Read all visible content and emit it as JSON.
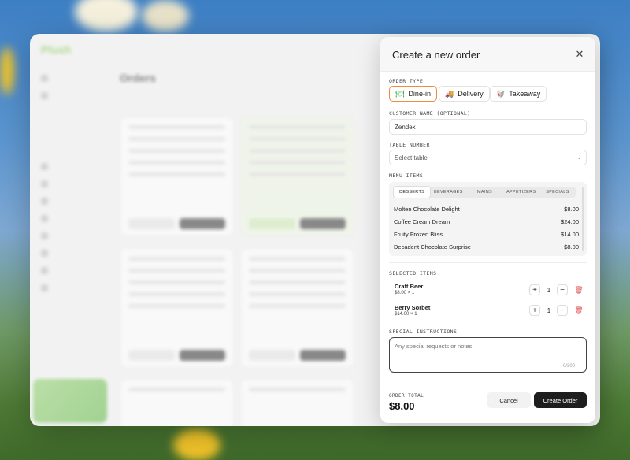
{
  "background": {
    "colors": {
      "sky": "#3d7fc4",
      "grass": "#4d7a35",
      "flower": "#f5f0dc",
      "yellow": "#f2c42a"
    }
  },
  "app": {
    "logo": "Plush",
    "search_placeholder": "",
    "orders_title": "Orders",
    "orders_subtitle": "",
    "accent": "#7ac943"
  },
  "panel": {
    "title": "Create a new order",
    "close_icon": "close-icon",
    "order_type": {
      "label": "ORDER TYPE",
      "options": [
        {
          "label": "Dine-in",
          "icon": "dine-in-icon",
          "active": true
        },
        {
          "label": "Delivery",
          "icon": "delivery-truck-icon",
          "active": false
        },
        {
          "label": "Takeaway",
          "icon": "takeaway-icon",
          "active": false
        }
      ],
      "accent": "#f08a3c"
    },
    "customer": {
      "label": "CUSTOMER NAME (OPTIONAL)",
      "value": "Zendex"
    },
    "table": {
      "label": "TABLE NUMBER",
      "placeholder": "Select table"
    },
    "menu": {
      "label": "MENU ITEMS",
      "tabs": [
        "DESSERTS",
        "BEVERAGES",
        "MAINS",
        "APPETIZERS",
        "SPECIALS"
      ],
      "active_tab": "DESSERTS",
      "items": [
        {
          "name": "Molten Chocolate Delight",
          "price": "$8.00"
        },
        {
          "name": "Coffee Cream Dream",
          "price": "$24.00"
        },
        {
          "name": "Fruity Frozen Bliss",
          "price": "$14.00"
        },
        {
          "name": "Decadent Chocolate Surprise",
          "price": "$8.00"
        }
      ]
    },
    "selected": {
      "label": "SELECTED ITEMS",
      "items": [
        {
          "name": "Craft Beer",
          "detail": "$8.00 × 1",
          "qty": "1"
        },
        {
          "name": "Berry Sorbet",
          "detail": "$14.00 × 1",
          "qty": "1"
        }
      ]
    },
    "instructions": {
      "label": "SPECIAL INSTRUCTIONS",
      "placeholder": "Any special requests or notes",
      "counter": "0/200"
    },
    "footer": {
      "total_label": "ORDER TOTAL",
      "total": "$8.00",
      "cancel": "Cancel",
      "create": "Create Order"
    }
  }
}
